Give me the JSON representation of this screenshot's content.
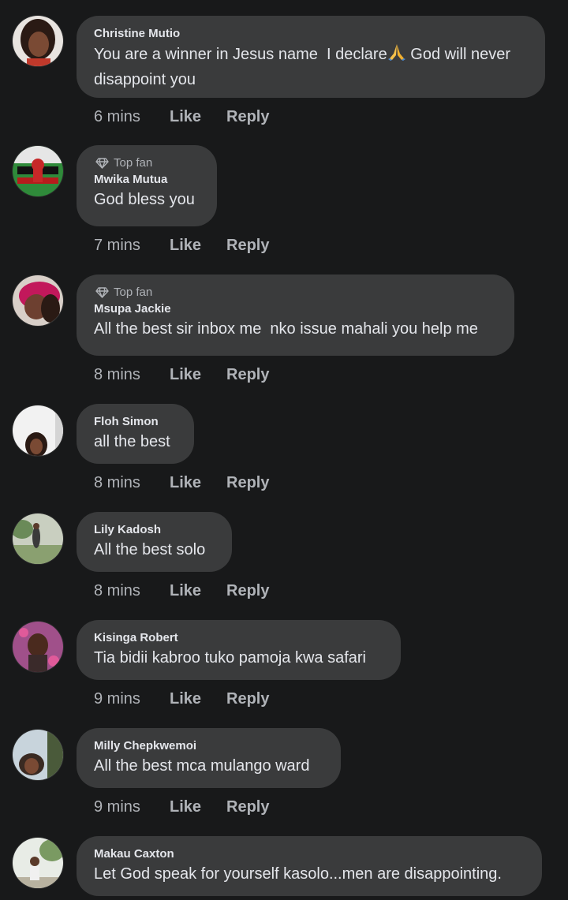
{
  "comments": [
    {
      "author": "Christine Mutio",
      "text_part1": "You are a winner in Jesus name  I declare",
      "text_part2": " God will never disappoint you",
      "time": "6 mins",
      "like": "Like",
      "reply": "Reply"
    },
    {
      "badge": "Top fan",
      "author": "Mwika Mutua",
      "text": "God bless you",
      "time": "7 mins",
      "like": "Like",
      "reply": "Reply"
    },
    {
      "badge": "Top fan",
      "author": "Msupa Jackie",
      "text": "All the best sir inbox me  nko issue mahali you help me",
      "time": "8 mins",
      "like": "Like",
      "reply": "Reply"
    },
    {
      "author": "Floh Simon",
      "text": "all the best",
      "time": "8 mins",
      "like": "Like",
      "reply": "Reply"
    },
    {
      "author": "Lily Kadosh",
      "text": "All the best solo",
      "time": "8 mins",
      "like": "Like",
      "reply": "Reply"
    },
    {
      "author": "Kisinga Robert",
      "text": "Tia bidii kabroo tuko pamoja kwa safari",
      "time": "9 mins",
      "like": "Like",
      "reply": "Reply"
    },
    {
      "author": "Milly Chepkwemoi",
      "text": "All the best mca mulango ward",
      "time": "9 mins",
      "like": "Like",
      "reply": "Reply"
    },
    {
      "author": "Makau Caxton",
      "text": "Let God speak for yourself kasolo...men are disappointing."
    }
  ]
}
